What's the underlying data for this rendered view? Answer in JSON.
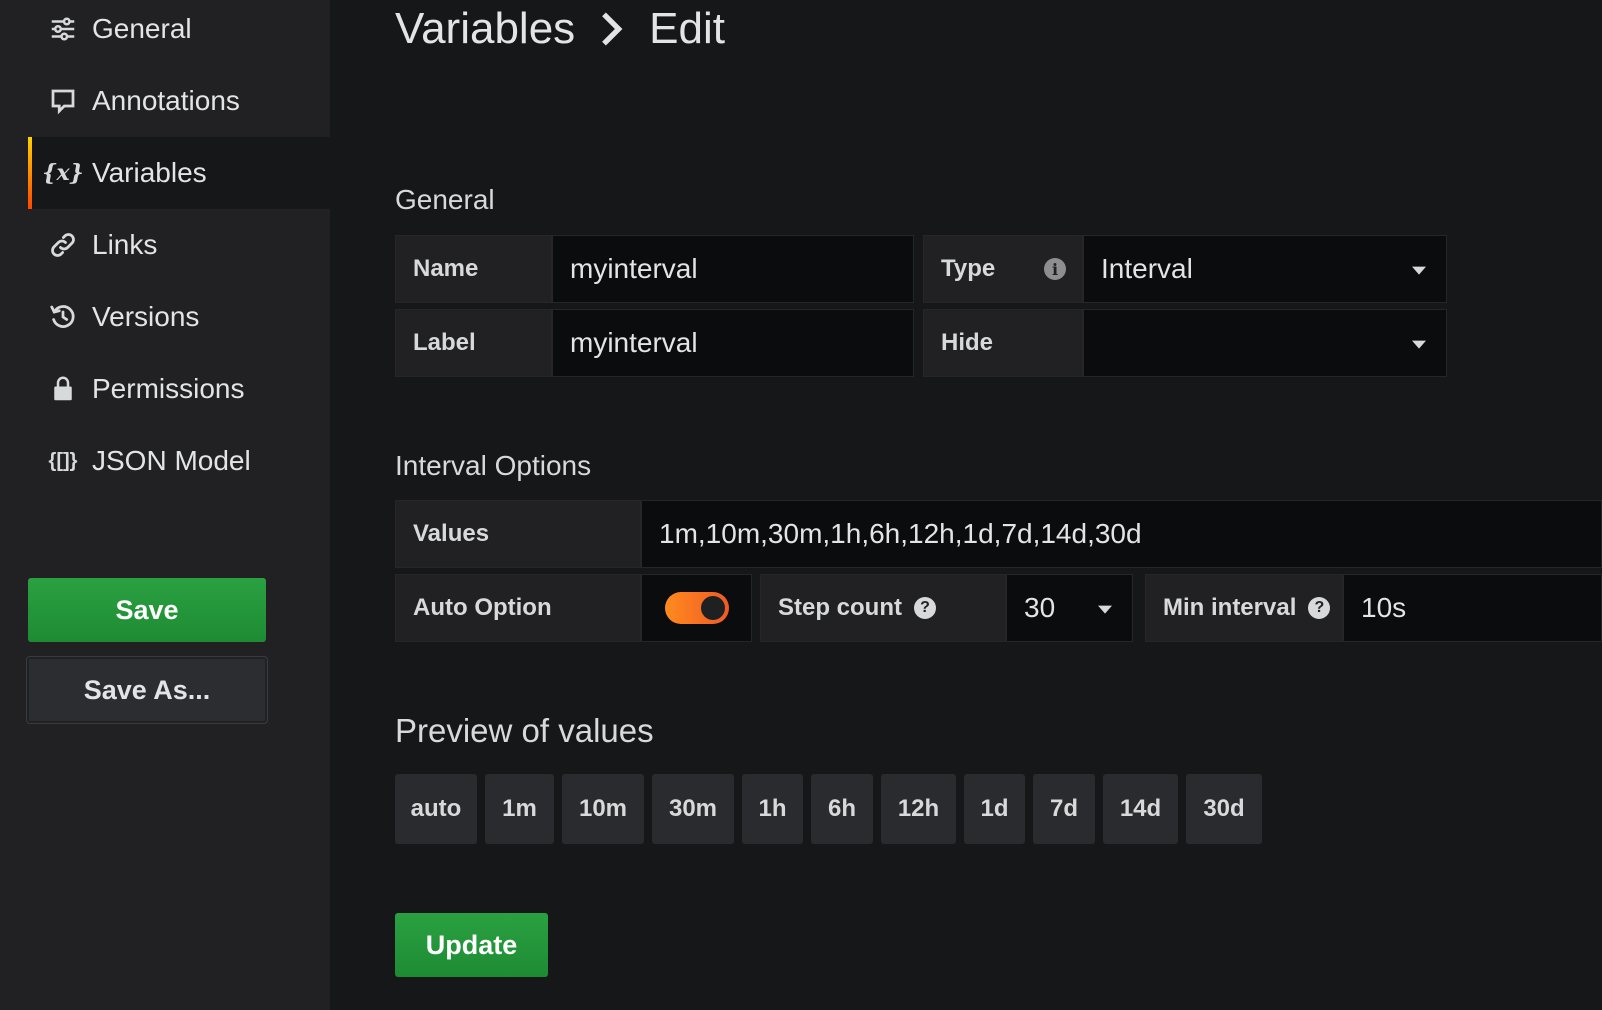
{
  "sidebar": {
    "items": [
      {
        "label": "General",
        "icon": "sliders-icon"
      },
      {
        "label": "Annotations",
        "icon": "comment-icon"
      },
      {
        "label": "Variables",
        "icon": "variable-icon",
        "active": true
      },
      {
        "label": "Links",
        "icon": "link-icon"
      },
      {
        "label": "Versions",
        "icon": "history-icon"
      },
      {
        "label": "Permissions",
        "icon": "lock-icon"
      },
      {
        "label": "JSON Model",
        "icon": "json-icon"
      }
    ],
    "save_label": "Save",
    "save_as_label": "Save As..."
  },
  "header": {
    "crumb_parent": "Variables",
    "crumb_current": "Edit"
  },
  "general": {
    "title": "General",
    "name_label": "Name",
    "name_value": "myinterval",
    "label_label": "Label",
    "label_value": "myinterval",
    "type_label": "Type",
    "type_value": "Interval",
    "hide_label": "Hide",
    "hide_value": ""
  },
  "interval_options": {
    "title": "Interval Options",
    "values_label": "Values",
    "values_value": "1m,10m,30m,1h,6h,12h,1d,7d,14d,30d",
    "auto_option_label": "Auto Option",
    "auto_option_on": true,
    "step_count_label": "Step count",
    "step_count_value": "30",
    "min_interval_label": "Min interval",
    "min_interval_value": "10s",
    "help_glyph": "?",
    "info_glyph": "i"
  },
  "preview": {
    "title": "Preview of values",
    "values": [
      "auto",
      "1m",
      "10m",
      "30m",
      "1h",
      "6h",
      "12h",
      "1d",
      "7d",
      "14d",
      "30d"
    ]
  },
  "update_label": "Update",
  "colors": {
    "accent_green": "#2aa141",
    "switch_orange": "#ff8a1e",
    "active_border": "#ff9900"
  }
}
